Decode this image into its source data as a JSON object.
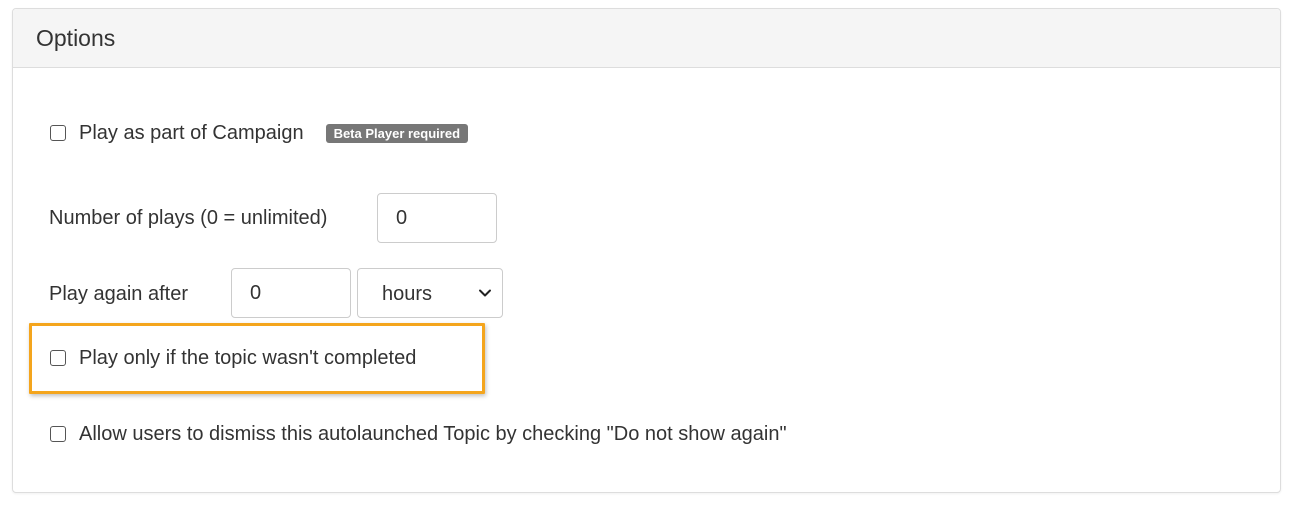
{
  "panel": {
    "title": "Options"
  },
  "campaign": {
    "label": "Play as part of Campaign",
    "checked": false,
    "badge": "Beta Player required"
  },
  "number_of_plays": {
    "label": "Number of plays (0 = unlimited)",
    "value": "0"
  },
  "play_again": {
    "label": "Play again after",
    "value": "0",
    "unit_selected": "hours"
  },
  "only_if_not_completed": {
    "label": "Play only if the topic wasn't completed",
    "checked": false
  },
  "allow_dismiss": {
    "label": "Allow users to dismiss this autolaunched Topic by checking \"Do not show again\"",
    "checked": false
  },
  "colors": {
    "highlight": "#f4a51d",
    "badge_bg": "#777777",
    "header_bg": "#f5f5f5"
  }
}
